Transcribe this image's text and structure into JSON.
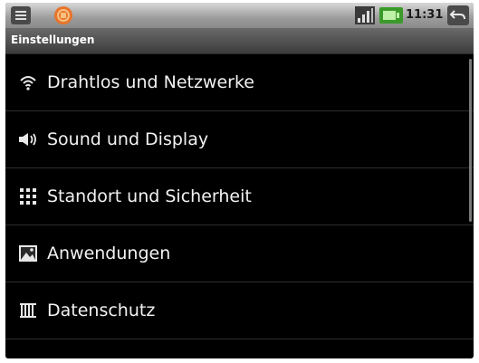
{
  "status_bar": {
    "time": "11:31",
    "icons": [
      "menu-icon",
      "app-icon",
      "signal-icon",
      "battery-icon",
      "back-icon"
    ],
    "colors": {
      "battery": "#3a9a2a",
      "app": "#e8742a"
    }
  },
  "header": {
    "title": "Einstellungen"
  },
  "settings": {
    "items": [
      {
        "label": "Drahtlos und Netzwerke",
        "icon": "wifi-icon"
      },
      {
        "label": "Sound und Display",
        "icon": "speaker-icon"
      },
      {
        "label": "Standort und Sicherheit",
        "icon": "grid-dots-icon"
      },
      {
        "label": "Anwendungen",
        "icon": "image-icon"
      },
      {
        "label": "Datenschutz",
        "icon": "bars-icon"
      }
    ]
  }
}
